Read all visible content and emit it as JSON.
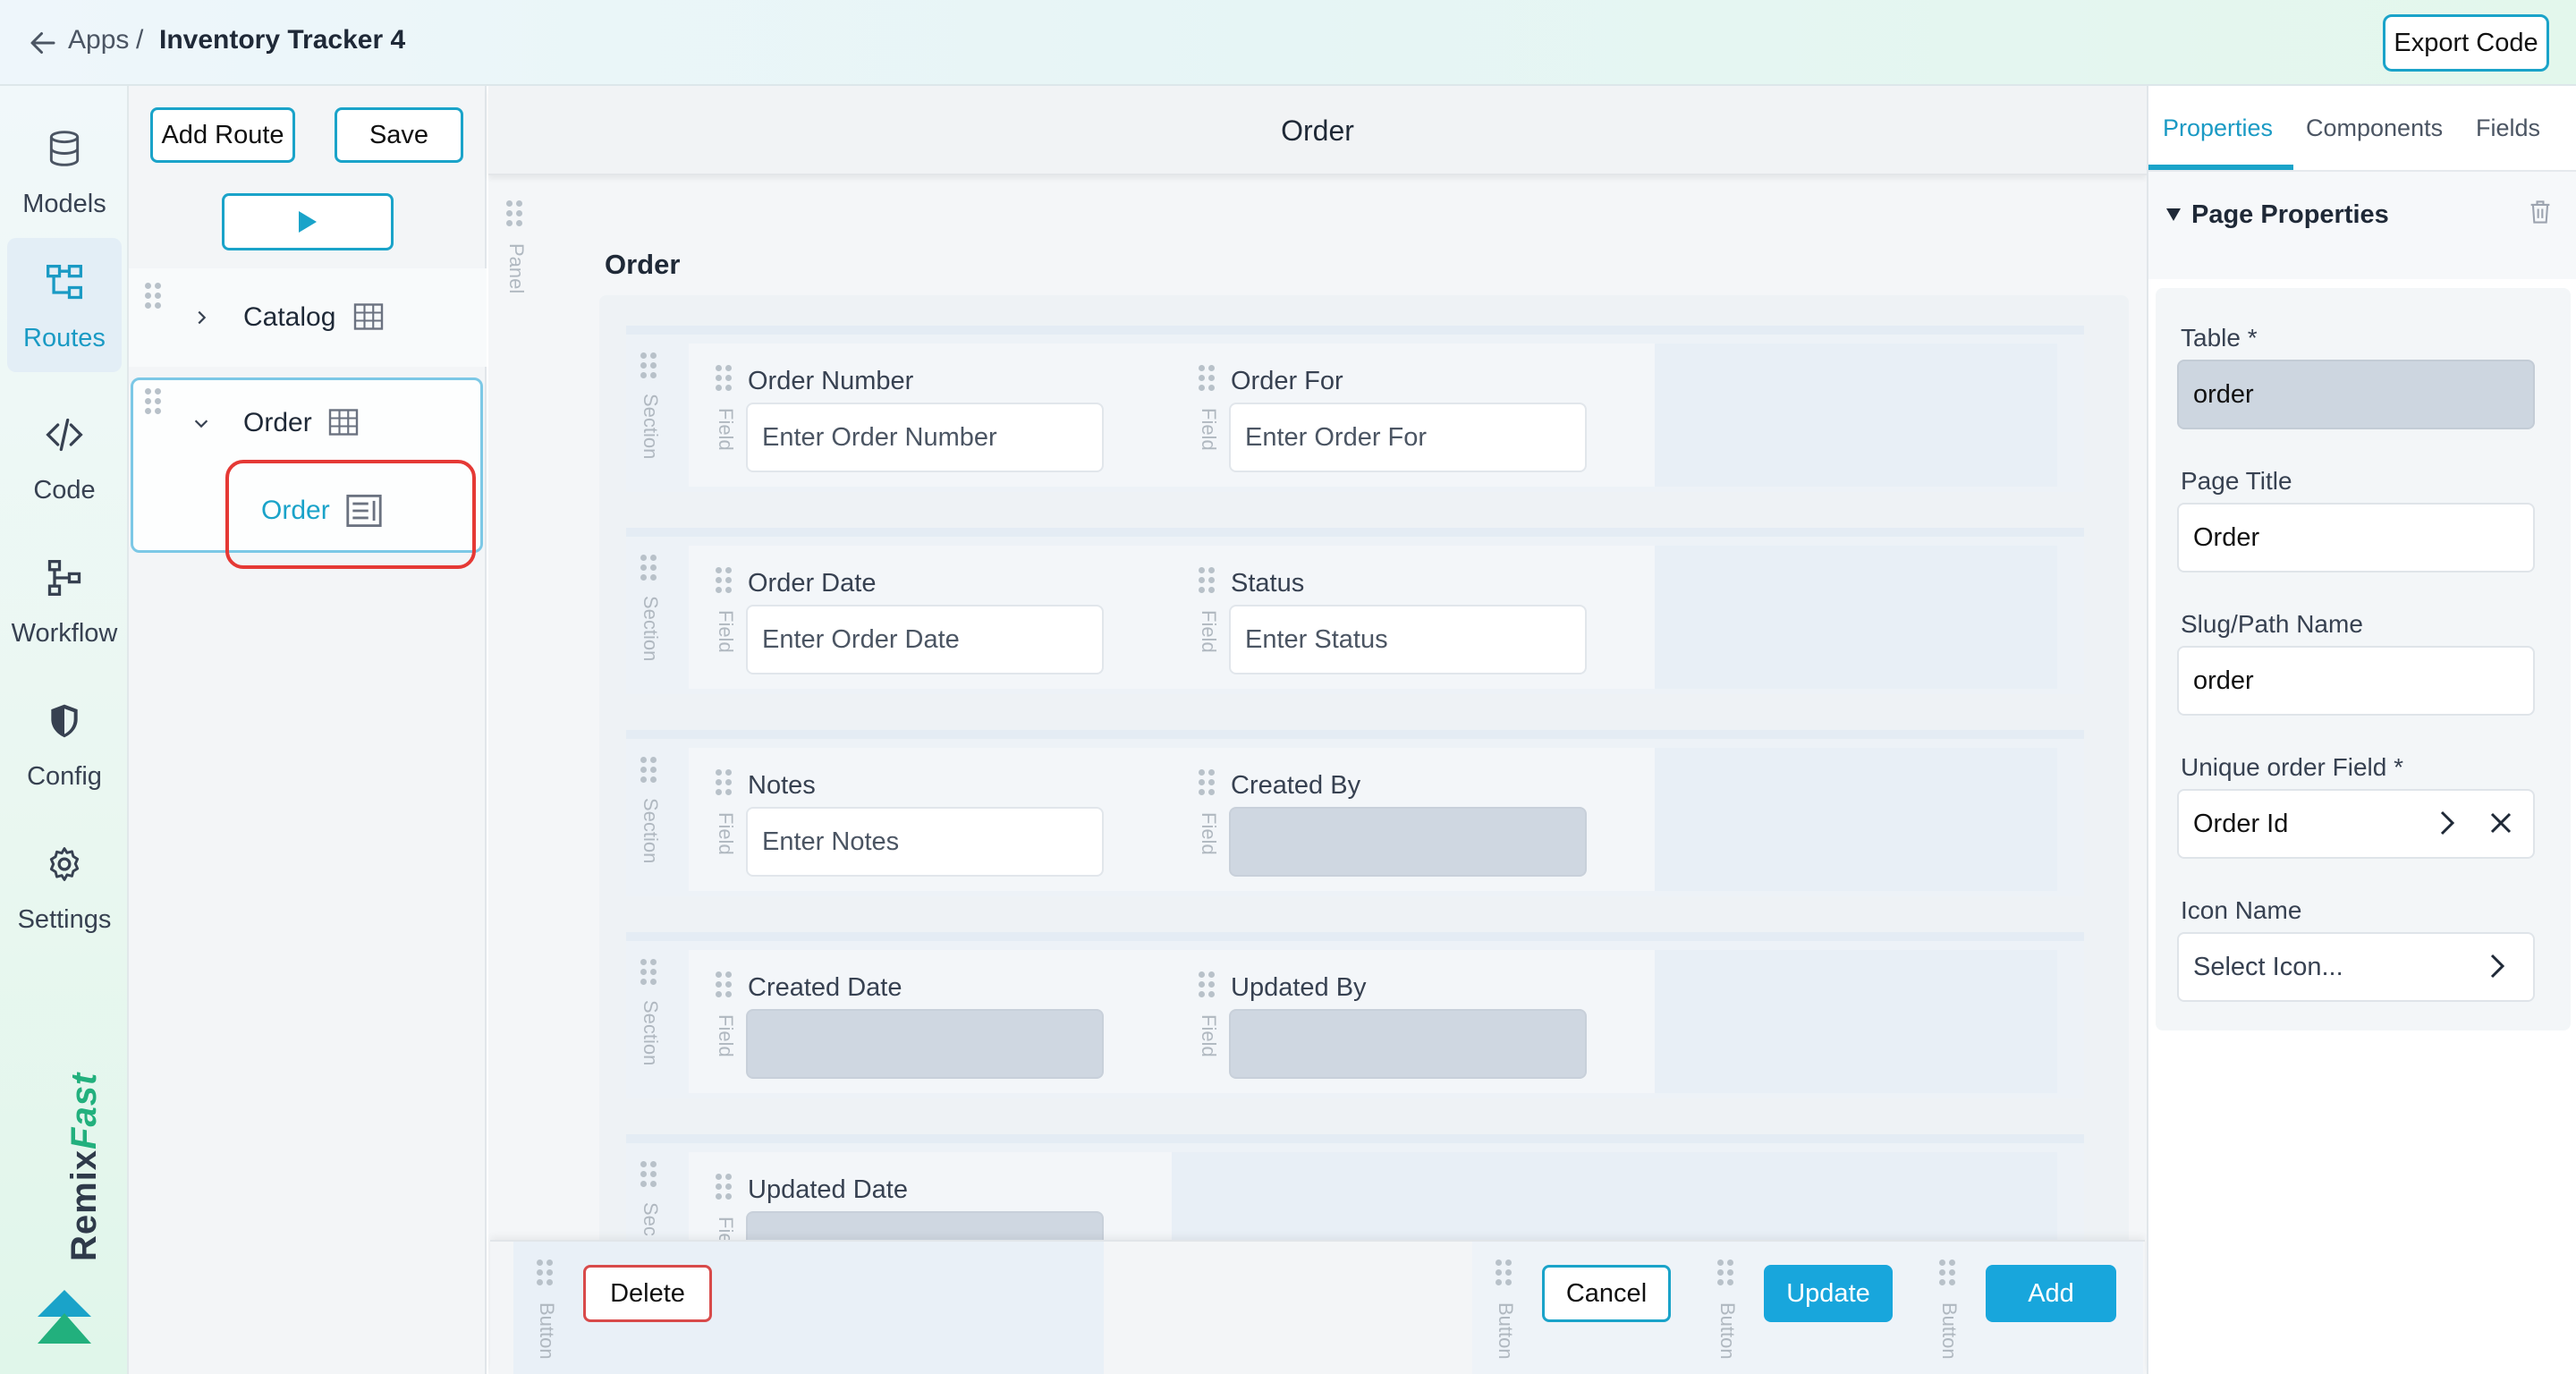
{
  "topbar": {
    "breadcrumb_apps": "Apps",
    "breadcrumb_sep": "/",
    "app_title": "Inventory Tracker 4",
    "export_label": "Export Code"
  },
  "rail": {
    "items": [
      {
        "label": "Models",
        "icon": "database-icon"
      },
      {
        "label": "Routes",
        "icon": "routes-icon",
        "active": true
      },
      {
        "label": "Code",
        "icon": "code-icon"
      },
      {
        "label": "Workflow",
        "icon": "workflow-icon"
      },
      {
        "label": "Config",
        "icon": "shield-icon"
      },
      {
        "label": "Settings",
        "icon": "gear-icon"
      }
    ],
    "brand_primary": "Remix",
    "brand_accent": "Fast"
  },
  "routes": {
    "add_route_label": "Add Route",
    "save_label": "Save",
    "items": [
      {
        "label": "Catalog",
        "expanded": false,
        "icon": "table-icon"
      },
      {
        "label": "Order",
        "expanded": true,
        "icon": "table-icon",
        "children": [
          {
            "label": "Order",
            "icon": "form-icon",
            "highlighted": true
          }
        ]
      }
    ]
  },
  "canvas": {
    "page_title": "Order",
    "panel_side_label": "Panel",
    "panel_title": "Order",
    "section_side_label": "Section",
    "field_side_label": "Field",
    "sections": [
      {
        "fields": [
          {
            "label": "Order Number",
            "placeholder": "Enter Order Number",
            "disabled": false
          },
          {
            "label": "Order For",
            "placeholder": "Enter Order For",
            "disabled": false
          }
        ]
      },
      {
        "fields": [
          {
            "label": "Order Date",
            "placeholder": "Enter Order Date",
            "disabled": false
          },
          {
            "label": "Status",
            "placeholder": "Enter Status",
            "disabled": false
          }
        ]
      },
      {
        "fields": [
          {
            "label": "Notes",
            "placeholder": "Enter Notes",
            "disabled": false
          },
          {
            "label": "Created By",
            "placeholder": "",
            "disabled": true
          }
        ]
      },
      {
        "fields": [
          {
            "label": "Created Date",
            "placeholder": "",
            "disabled": true
          },
          {
            "label": "Updated By",
            "placeholder": "",
            "disabled": true
          }
        ]
      },
      {
        "fields": [
          {
            "label": "Updated Date",
            "placeholder": "",
            "disabled": true
          }
        ]
      }
    ],
    "section_side_label_short": "Sec",
    "field_side_label_short": "Fie"
  },
  "actions": {
    "button_side_label": "Button",
    "delete_label": "Delete",
    "cancel_label": "Cancel",
    "update_label": "Update",
    "add_label": "Add"
  },
  "properties": {
    "tabs": [
      "Properties",
      "Components",
      "Fields"
    ],
    "section_title": "Page Properties",
    "table_label": "Table *",
    "table_value": "order",
    "page_title_label": "Page Title",
    "page_title_value": "Order",
    "slug_label": "Slug/Path Name",
    "slug_value": "order",
    "unique_label": "Unique order Field *",
    "unique_value": "Order Id",
    "icon_label": "Icon Name",
    "icon_placeholder": "Select Icon..."
  },
  "colors": {
    "accent": "#1aa3c9",
    "primary_button": "#18a6dc",
    "danger_border": "#d84a4a",
    "highlight_box": "#e53935",
    "brand_green": "#22b07d"
  }
}
